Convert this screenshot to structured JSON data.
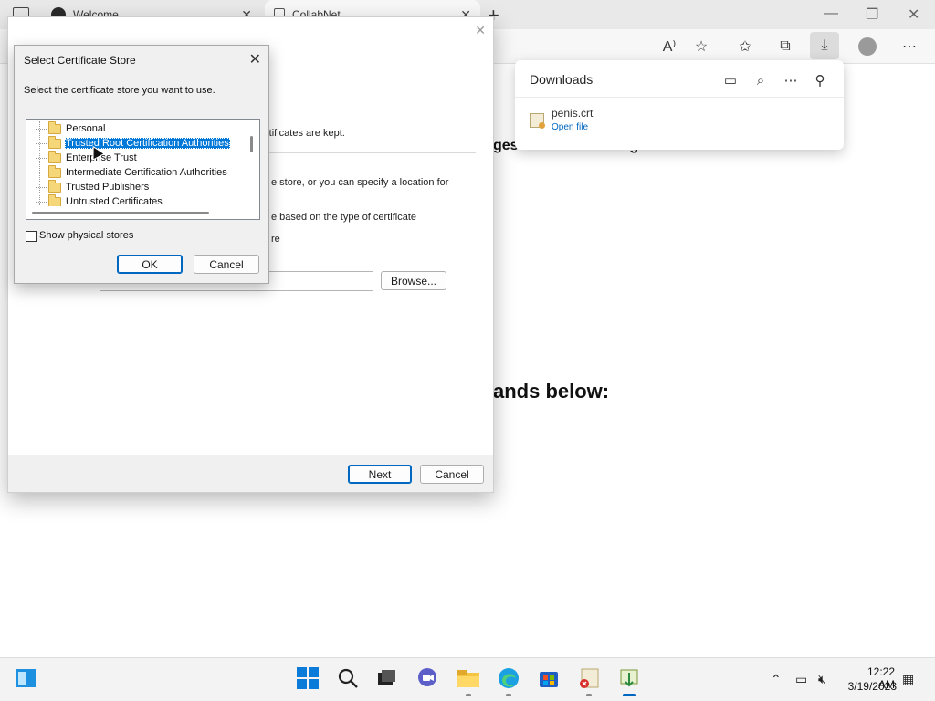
{
  "browser": {
    "tabs": [
      {
        "title": "Welcome"
      },
      {
        "title": "CollabNet"
      }
    ],
    "new_tab_label": "+",
    "minimize": "—",
    "restore": "❐",
    "close": "✕",
    "toolbar_icons": [
      "read-aloud-icon",
      "add-favorite-icon",
      "favorites-icon",
      "collections-icon",
      "downloads-icon",
      "profile-icon",
      "more-icon"
    ]
  },
  "page": {
    "heading_top": "ges to CollabNet in general",
    "heading_commands": "ands below:"
  },
  "downloads": {
    "title": "Downloads",
    "file_name": "penis.crt",
    "open_file": "Open file"
  },
  "wizard": {
    "line1": "rtificates are kept.",
    "line2": "e store, or you can specify a location for",
    "line3": "e based on the type of certificate",
    "line4": "re",
    "browse": "Browse...",
    "next": "Next",
    "cancel": "Cancel"
  },
  "store_dialog": {
    "title": "Select Certificate Store",
    "prompt": "Select the certificate store you want to use.",
    "stores": [
      {
        "label": "Personal",
        "selected": false
      },
      {
        "label": "Trusted Root Certification Authorities",
        "selected": true
      },
      {
        "label": "Enterprise Trust",
        "selected": false
      },
      {
        "label": "Intermediate Certification Authorities",
        "selected": false
      },
      {
        "label": "Trusted Publishers",
        "selected": false
      },
      {
        "label": "Untrusted Certificates",
        "selected": false
      }
    ],
    "show_physical": "Show physical stores",
    "show_physical_checked": false,
    "ok": "OK",
    "cancel": "Cancel"
  },
  "taskbar": {
    "time": "12:22 AM",
    "date": "3/19/2023",
    "apps": [
      "start-icon",
      "search-icon",
      "task-view-icon",
      "chat-icon",
      "file-explorer-icon",
      "edge-icon",
      "store-icon",
      "certificate-error-icon",
      "certificate-import-icon"
    ]
  }
}
